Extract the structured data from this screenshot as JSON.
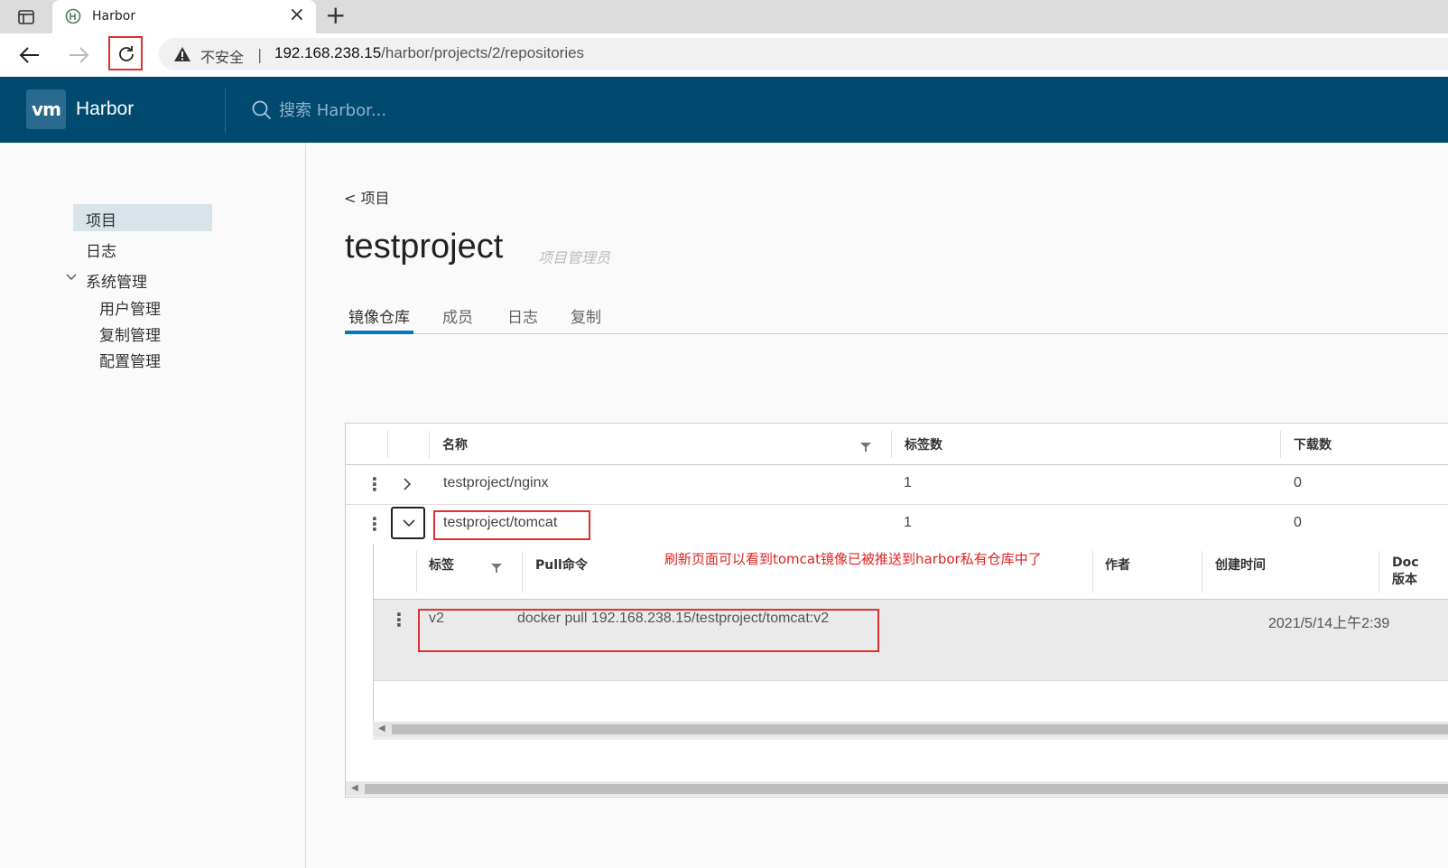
{
  "browser": {
    "tab_title": "Harbor",
    "tab_close": "×",
    "new_tab": "+",
    "insecure_label": "不安全",
    "separator": "|",
    "url_host": "192.168.238.15",
    "url_path": "/harbor/projects/2/repositories"
  },
  "header": {
    "logo_text": "vm",
    "app_name": "Harbor",
    "search_placeholder": "搜索 Harbor..."
  },
  "sidebar": {
    "projects": "项目",
    "logs": "日志",
    "admin": "系统管理",
    "admin_items": [
      "用户管理",
      "复制管理",
      "配置管理"
    ]
  },
  "main": {
    "back_link": "< 项目",
    "project_name": "testproject",
    "role": "项目管理员",
    "tabs": [
      "镜像仓库",
      "成员",
      "日志",
      "复制"
    ]
  },
  "grid": {
    "headers": {
      "name": "名称",
      "tags": "标签数",
      "pulls": "下载数"
    },
    "rows": [
      {
        "name": "testproject/nginx",
        "tags": "1",
        "pulls": "0"
      },
      {
        "name": "testproject/tomcat",
        "tags": "1",
        "pulls": "0"
      }
    ]
  },
  "detail": {
    "headers": {
      "tag": "标签",
      "pull": "Pull命令",
      "author": "作者",
      "created": "创建时间",
      "docker_a": "Doc",
      "docker_b": "版本"
    },
    "annotation": "刷新页面可以看到tomcat镜像已被推送到harbor私有仓库中了",
    "rows": [
      {
        "tag": "v2",
        "pull": "docker pull 192.168.238.15/testproject/tomcat:v2",
        "created": "2021/5/14上午2:39"
      }
    ]
  },
  "colors": {
    "header_bg": "#004a70",
    "accent": "#0079b8",
    "highlight": "#e03030"
  },
  "icons": [
    "tab-actions-icon",
    "harbor-favicon",
    "back-arrow-icon",
    "forward-arrow-icon",
    "reload-icon",
    "warning-icon",
    "search-icon",
    "chevron-down-icon",
    "chevron-right-icon",
    "kebab-icon",
    "filter-icon"
  ]
}
